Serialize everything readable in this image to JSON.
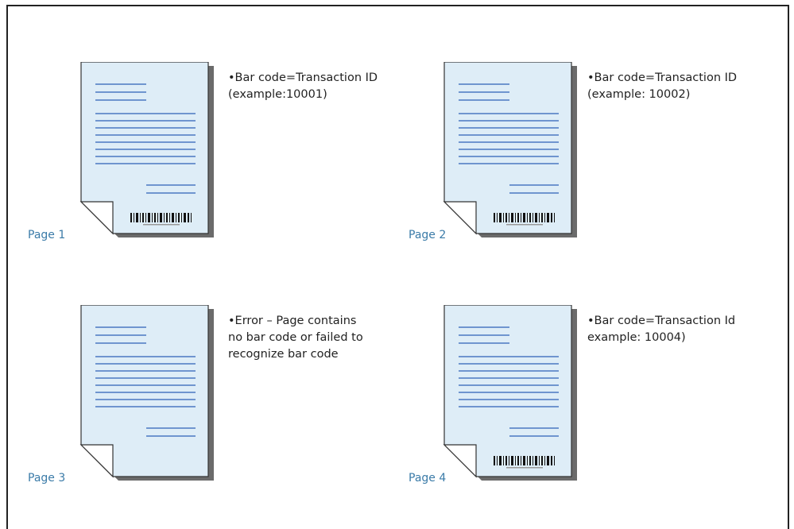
{
  "pages": [
    {
      "label": "Page 1",
      "note_lines": [
        "•Bar code=Transaction ID",
        "(example:10001)"
      ],
      "has_barcode": true
    },
    {
      "label": "Page 2",
      "note_lines": [
        "•Bar code=Transaction ID",
        "(example: 10002)"
      ],
      "has_barcode": true
    },
    {
      "label": "Page 3",
      "note_lines": [
        "•Error – Page contains",
        "no bar code or failed to",
        "recognize bar code"
      ],
      "has_barcode": false
    },
    {
      "label": "Page 4",
      "note_lines": [
        "•Bar code=Transaction Id",
        "example: 10004)"
      ],
      "has_barcode": true
    }
  ],
  "colors": {
    "paper": "#deedf7",
    "line": "#4a78c2",
    "shadow": "#6b6b6b",
    "label": "#3b7ba8"
  }
}
